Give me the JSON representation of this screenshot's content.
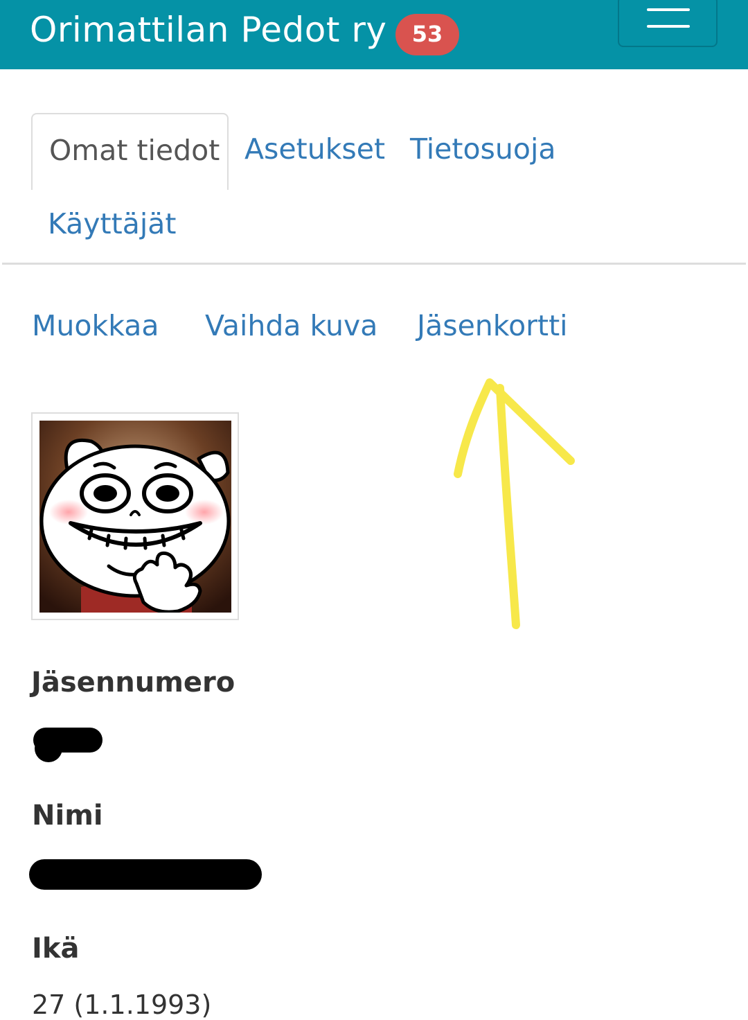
{
  "header": {
    "brand": "Orimattilan Pedot ry",
    "badge_count": "53",
    "menu_icon": "hamburger-icon"
  },
  "tabs": [
    {
      "label": "Omat tiedot",
      "active": true
    },
    {
      "label": "Asetukset",
      "active": false
    },
    {
      "label": "Tietosuoja",
      "active": false
    },
    {
      "label": "Käyttäjät",
      "active": false
    }
  ],
  "actions": [
    {
      "label": "Muokkaa"
    },
    {
      "label": "Vaihda kuva"
    },
    {
      "label": "Jäsenkortti"
    }
  ],
  "profile": {
    "avatar_icon": "cartoon-pig-avatar",
    "fields": [
      {
        "label": "Jäsennumero",
        "value": "[redacted]"
      },
      {
        "label": "Nimi",
        "value": "[redacted]"
      },
      {
        "label": "Ikä",
        "value": "27 (1.1.1993)"
      }
    ]
  },
  "annotation": {
    "icon": "arrow-up-icon",
    "color": "#f7e84a"
  },
  "colors": {
    "navbar": "#0592a6",
    "badge": "#d9534f",
    "link": "#337ab7"
  }
}
